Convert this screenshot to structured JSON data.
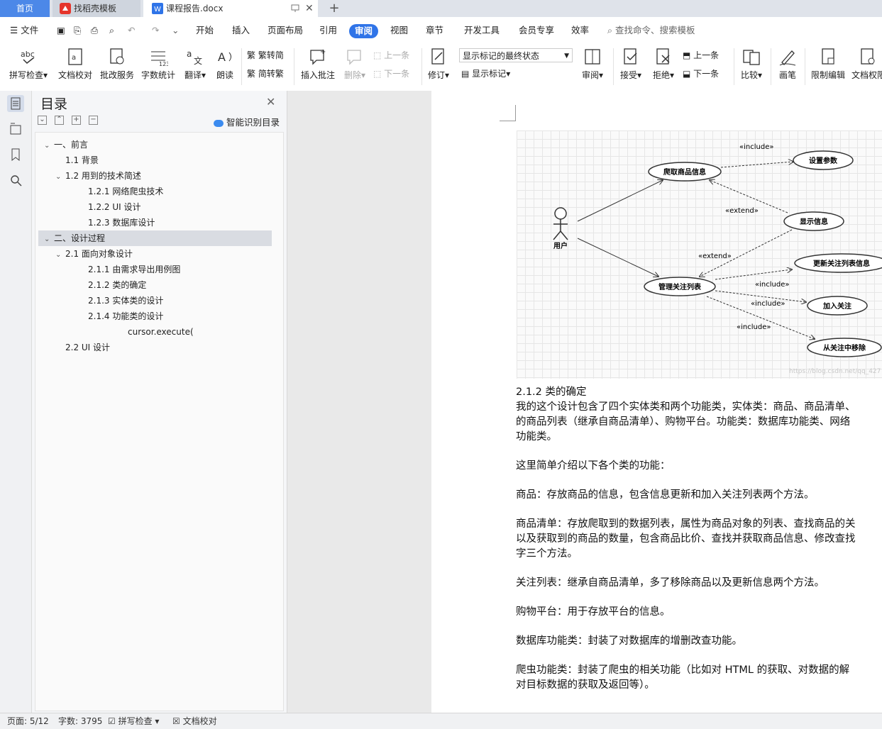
{
  "tabs": {
    "home": "首页",
    "template": "找稻壳模板",
    "document": "课程报告.docx"
  },
  "menu": {
    "file": "文件",
    "items": [
      "开始",
      "插入",
      "页面布局",
      "引用",
      "审阅",
      "视图",
      "章节",
      "开发工具",
      "会员专享",
      "效率"
    ],
    "active": "审阅",
    "search": "查找命令、搜索模板"
  },
  "ribbon": {
    "spellcheck": "拼写检查",
    "doc_proof": "文档校对",
    "correction": "批改服务",
    "word_count": "字数统计",
    "translate": "翻译",
    "read_aloud": "朗读",
    "trad_to_simp": "繁转简",
    "simp_to_trad": "简转繁",
    "insert_comment": "插入批注",
    "delete": "删除",
    "prev": "上一条",
    "next": "下一条",
    "track_state": "显示标记的最终状态",
    "revise": "修订",
    "show_markup": "显示标记",
    "review": "审阅",
    "accept": "接受",
    "reject": "拒绝",
    "prev2": "上一条",
    "next2": "下一条",
    "compare": "比较",
    "pen": "画笔",
    "restrict": "限制编辑",
    "doc_rights": "文档权限"
  },
  "toc": {
    "title": "目录",
    "smart": "智能识别目录",
    "items": [
      {
        "label": "一、前言",
        "level": 1,
        "arrow": "down"
      },
      {
        "label": "1.1  背景",
        "level": 2,
        "arrow": ""
      },
      {
        "label": "1.2  用到的技术简述",
        "level": 2,
        "arrow": "down"
      },
      {
        "label": "1.2.1  网络爬虫技术",
        "level": 3,
        "arrow": ""
      },
      {
        "label": "1.2.2 UI 设计",
        "level": 3,
        "arrow": ""
      },
      {
        "label": "1.2.3  数据库设计",
        "level": 3,
        "arrow": ""
      },
      {
        "label": "二、设计过程",
        "level": 1,
        "arrow": "down",
        "selected": true
      },
      {
        "label": "2.1  面向对象设计",
        "level": 2,
        "arrow": "down"
      },
      {
        "label": "2.1.1  由需求导出用例图",
        "level": 3,
        "arrow": ""
      },
      {
        "label": "2.1.2  类的确定",
        "level": 3,
        "arrow": ""
      },
      {
        "label": "2.1.3  实体类的设计",
        "level": 3,
        "arrow": ""
      },
      {
        "label": "2.1.4  功能类的设计",
        "level": 3,
        "arrow": ""
      },
      {
        "label": "cursor.execute(",
        "level": 4,
        "arrow": ""
      },
      {
        "label": "2.2 UI 设计",
        "level": 2,
        "arrow": ""
      }
    ]
  },
  "diagram": {
    "actor": "用户",
    "usecases": {
      "crawl": "爬取商品信息",
      "params": "设置参数",
      "show": "显示信息",
      "manage": "管理关注列表",
      "update": "更新关注列表信息",
      "add": "加入关注",
      "remove": "从关注中移除"
    },
    "include": "«include»",
    "extend": "«extend»",
    "watermark": "https://blog.csdn.net/qq_427"
  },
  "body": {
    "heading": "2.1.2  类的确定",
    "p1a": "我的这个设计包含了四个实体类和两个功能类，实体类：商品、商品清单、",
    "p1b": "的商品列表（继承自商品清单）、购物平台。功能类：数据库功能类、网络",
    "p1c": "功能类。",
    "p2": "这里简单介绍以下各个类的功能：",
    "p3": "商品：存放商品的信息，包含信息更新和加入关注列表两个方法。",
    "p4a": "商品清单：存放爬取到的数据列表，属性为商品对象的列表、查找商品的关",
    "p4b": "以及获取到的商品的数量，包含商品比价、查找并获取商品信息、修改查找",
    "p4c": "字三个方法。",
    "p5": "关注列表：继承自商品清单，多了移除商品以及更新信息两个方法。",
    "p6": "购物平台：用于存放平台的信息。",
    "p7": "数据库功能类：封装了对数据库的增删改查功能。",
    "p8a": "爬虫功能类：封装了爬虫的相关功能（比如对 HTML 的获取、对数据的解",
    "p8b": "对目标数据的获取及返回等）。"
  },
  "status": {
    "page": "页面: 5/12",
    "words": "字数: 3795",
    "spell": "拼写检查",
    "proof": "文档校对"
  }
}
